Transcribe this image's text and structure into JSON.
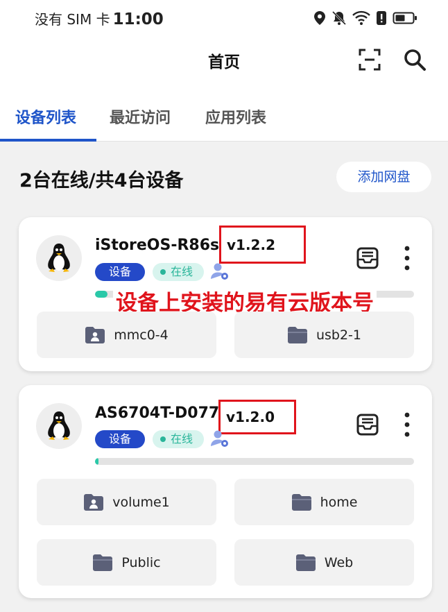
{
  "status_bar": {
    "carrier": "没有 SIM 卡",
    "time": "11:00",
    "icons": [
      "location-icon",
      "bell-off-icon",
      "wifi-icon",
      "alert-icon",
      "battery-icon"
    ]
  },
  "header": {
    "title": "首页",
    "icons": [
      "scan-icon",
      "search-icon"
    ]
  },
  "tabs": [
    {
      "label": "设备列表",
      "active": true
    },
    {
      "label": "最近访问",
      "active": false
    },
    {
      "label": "应用列表",
      "active": false
    }
  ],
  "summary": {
    "text": "2台在线/共4台设备",
    "add_button": "添加网盘"
  },
  "devices": [
    {
      "name": "iStoreOS-R86s",
      "version": "v1.2.2",
      "type_badge": "设备",
      "status_badge": "在线",
      "storage_used_fraction": 0.04,
      "annotation": "设备上安装的易有云版本号",
      "folders": [
        {
          "name": "mmc0-4",
          "icon": "user-folder-icon"
        },
        {
          "name": "usb2-1",
          "icon": "folder-icon"
        }
      ]
    },
    {
      "name": "AS6704T-D077",
      "version": "v1.2.0",
      "type_badge": "设备",
      "status_badge": "在线",
      "storage_used_fraction": 0.01,
      "folders": [
        {
          "name": "volume1",
          "icon": "user-folder-icon"
        },
        {
          "name": "home",
          "icon": "folder-icon"
        },
        {
          "name": "Public",
          "icon": "folder-icon"
        },
        {
          "name": "Web",
          "icon": "folder-icon"
        }
      ]
    }
  ],
  "colors": {
    "accent": "#1f55c9",
    "badge_device": "#2449c8",
    "online": "#2ab59a",
    "annotation_red": "#e0141c",
    "progress": "#2ac8a8",
    "folder": "#5b6078"
  }
}
